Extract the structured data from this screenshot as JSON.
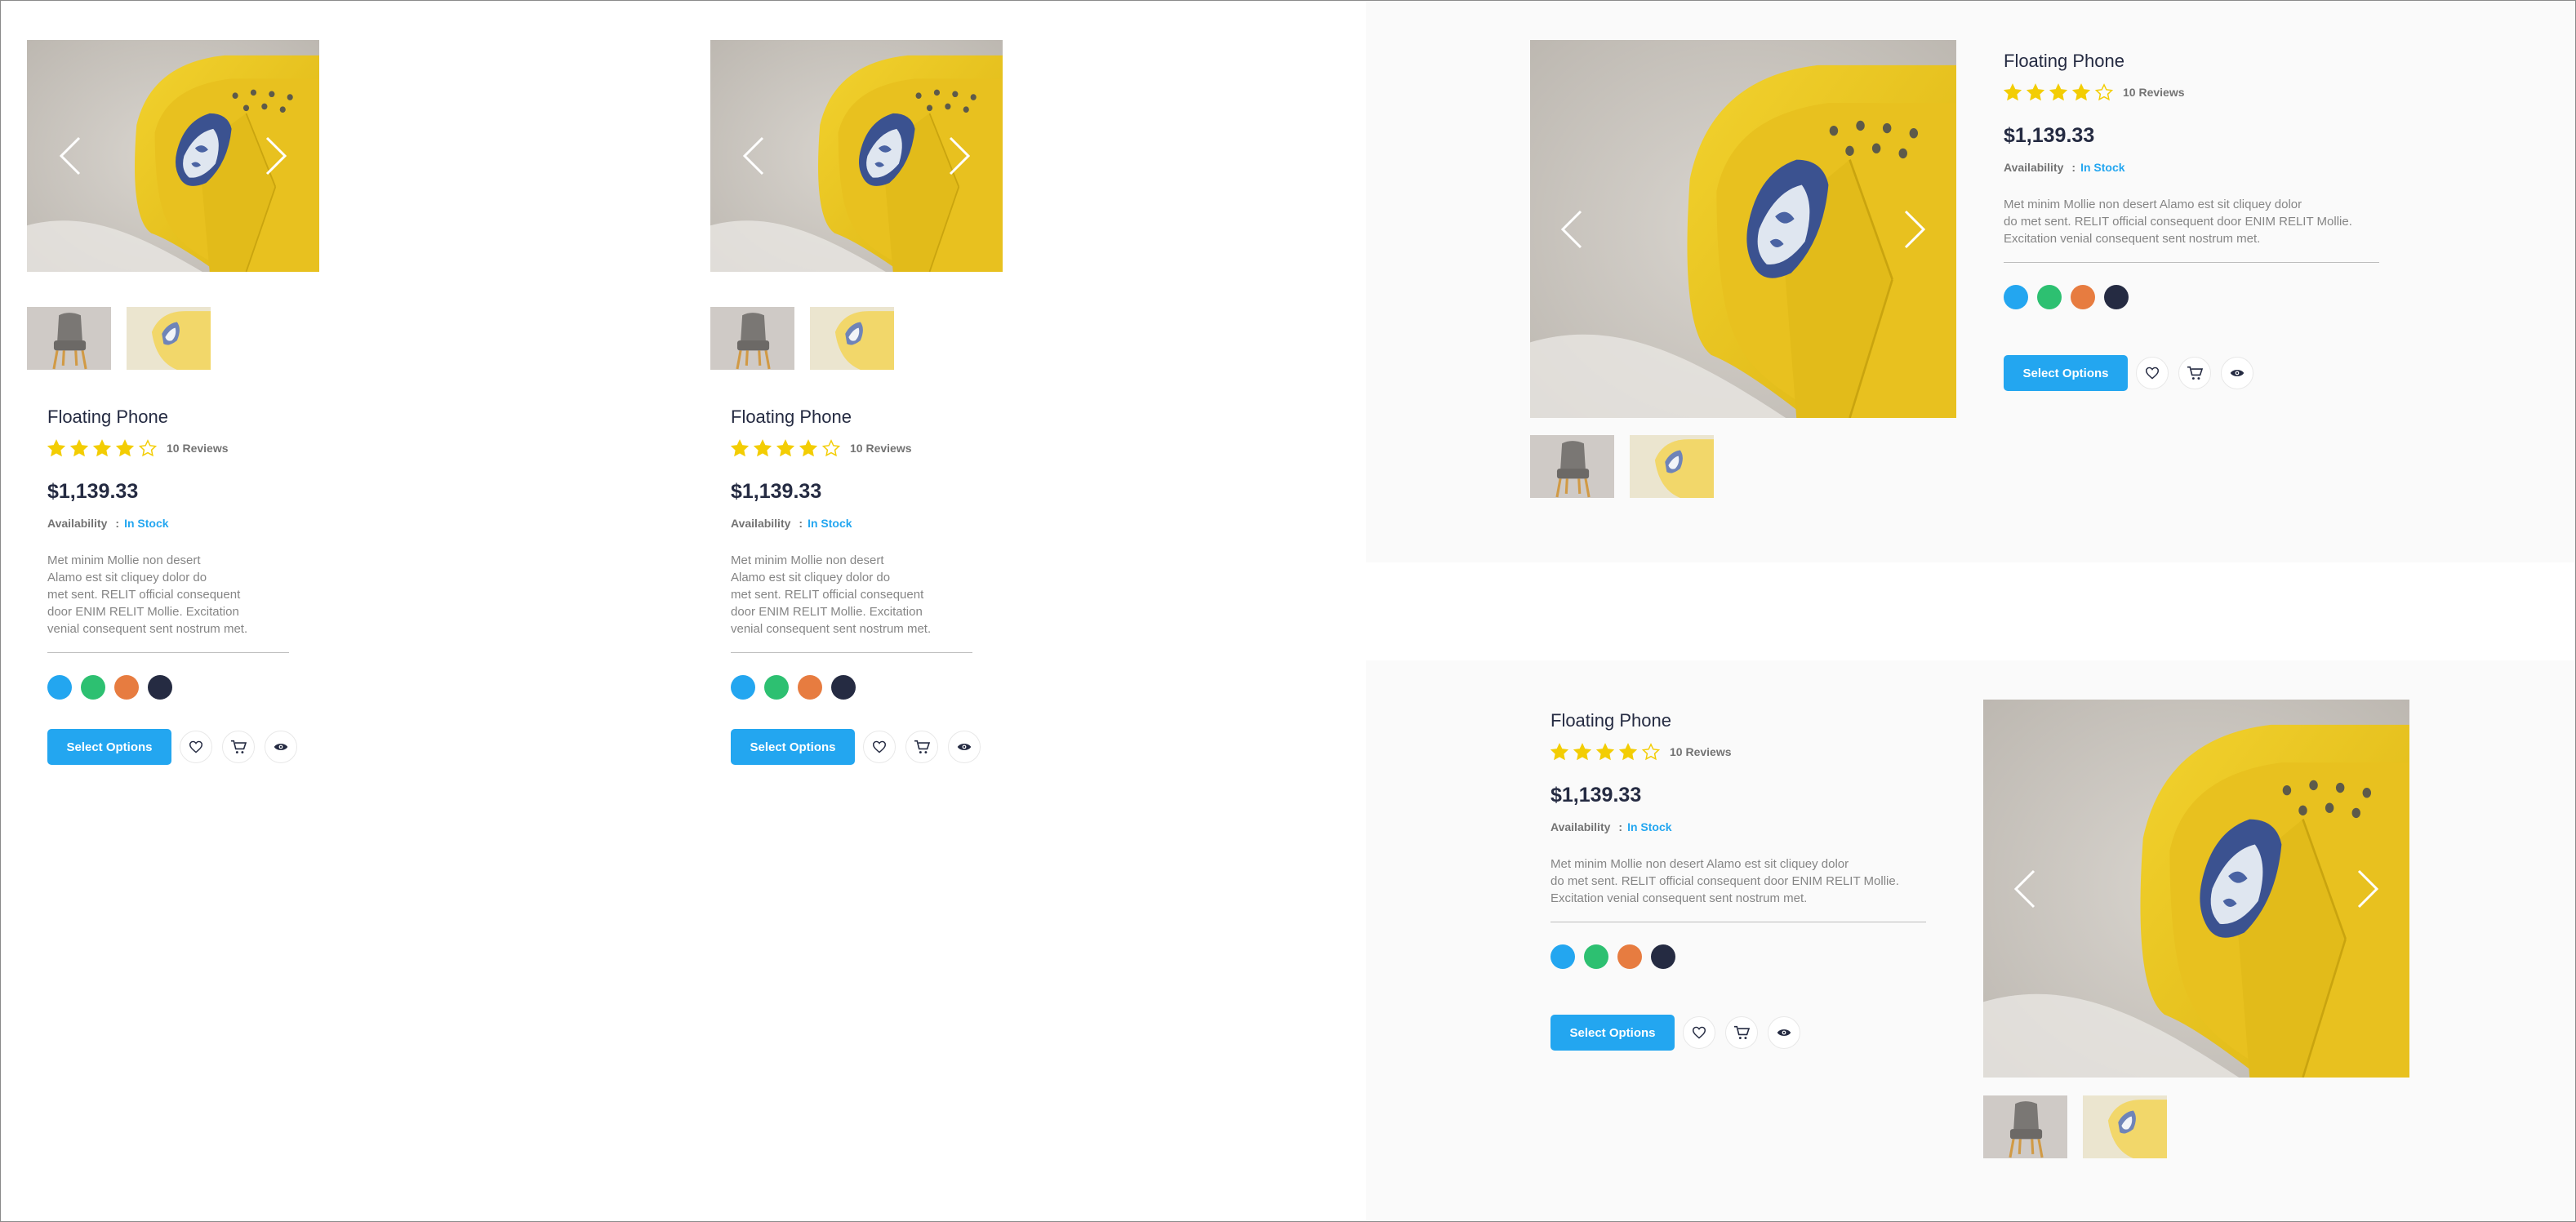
{
  "product": {
    "title": "Floating Phone",
    "rating": 4,
    "rating_max": 5,
    "reviews": "10 Reviews",
    "price": "$1,139.33",
    "availability_label": "Availability",
    "availability_sep": ":",
    "availability_value": "In Stock",
    "desc_narrow": [
      "Met minim Mollie non desert",
      "Alamo est sit cliquey dolor do",
      "met sent. RELIT official consequent",
      "door ENIM RELIT Mollie. Excitation",
      "venial consequent sent nostrum met."
    ],
    "desc_wide": [
      "Met minim Mollie non desert Alamo est sit cliquey dolor",
      "do met sent. RELIT official consequent door ENIM RELIT Mollie.",
      "Excitation venial consequent sent nostrum met."
    ],
    "colors": [
      "#23A6F0",
      "#2DC071",
      "#E77C40",
      "#252B42"
    ],
    "button_label": "Select Options",
    "icons": [
      "heart-icon",
      "cart-icon",
      "eye-icon"
    ],
    "accent_color": "#23A6F0",
    "star_color": "#F3CD03"
  }
}
